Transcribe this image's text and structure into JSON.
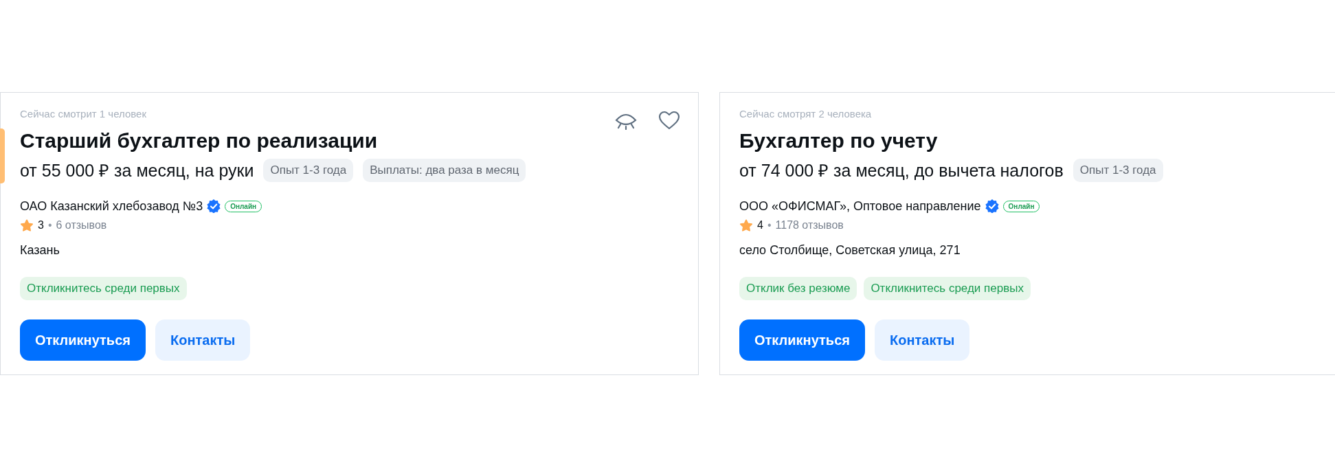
{
  "cards": [
    {
      "accent": true,
      "show_actions": true,
      "viewers": "Сейчас смотрит 1 человек",
      "title": "Старший бухгалтер по реализации",
      "salary": "от 55 000 ₽ за месяц, на руки",
      "tags": [
        "Опыт 1-3 года",
        "Выплаты: два раза в месяц"
      ],
      "company": "ОАО Казанский хлебозавод №3",
      "verified": true,
      "online": "Онлайн",
      "rating": "3",
      "separator": "•",
      "reviews": "6 отзывов",
      "location": "Казань",
      "badges": [
        "Откликнитесь среди первых"
      ],
      "buttons": [
        {
          "kind": "primary",
          "label": "Откликнуться"
        },
        {
          "kind": "secondary",
          "label": "Контакты"
        }
      ]
    },
    {
      "accent": false,
      "show_actions": false,
      "viewers": "Сейчас смотрят 2 человека",
      "title": "Бухгалтер по учету",
      "salary": "от 74 000 ₽ за месяц, до вычета налогов",
      "tags": [
        "Опыт 1-3 года"
      ],
      "company": "ООО «ОФИСМАГ», Оптовое направление",
      "verified": true,
      "online": "Онлайн",
      "rating": "4",
      "separator": "•",
      "reviews": "1178 отзывов",
      "location": "село Столбище, Советская улица, 271",
      "badges": [
        "Отклик без резюме",
        "Откликнитесь среди первых"
      ],
      "buttons": [
        {
          "kind": "primary",
          "label": "Откликнуться"
        },
        {
          "kind": "secondary",
          "label": "Контакты"
        }
      ]
    }
  ]
}
